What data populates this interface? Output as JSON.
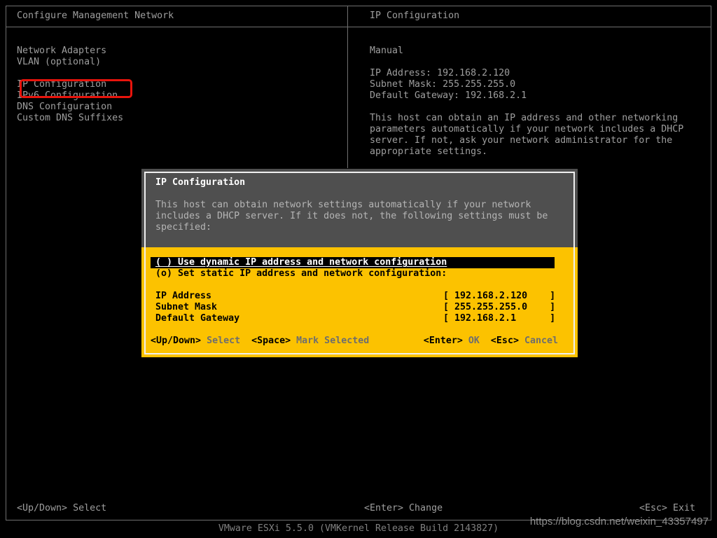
{
  "window": {
    "left_title": "Configure Management Network",
    "right_title": "IP Configuration"
  },
  "menu": {
    "items": [
      {
        "label": "Network Adapters"
      },
      {
        "label": "VLAN (optional)"
      },
      {
        "label": "IP Configuration",
        "annotated": true
      },
      {
        "label": "IPv6 Configuration"
      },
      {
        "label": "DNS Configuration"
      },
      {
        "label": "Custom DNS Suffixes"
      }
    ]
  },
  "details": {
    "mode": "Manual",
    "rows": [
      {
        "label": "IP Address:",
        "value": "192.168.2.120"
      },
      {
        "label": "Subnet Mask:",
        "value": "255.255.255.0"
      },
      {
        "label": "Default Gateway:",
        "value": "192.168.2.1"
      }
    ],
    "help_lines": [
      "This host can obtain an IP address and other networking",
      "parameters automatically if your network includes a DHCP",
      "server. If not, ask your network administrator for the",
      "appropriate settings."
    ]
  },
  "dialog": {
    "title": "IP Configuration",
    "body_lines": [
      "This host can obtain network settings automatically if your network",
      "includes a DHCP server. If it does not, the following settings must be",
      "specified:"
    ],
    "options": [
      {
        "text": "( ) Use dynamic IP address and network configuration",
        "focused": true,
        "checked": false
      },
      {
        "text": "(o) Set static IP address and network configuration:",
        "focused": false,
        "checked": true
      }
    ],
    "fields": [
      {
        "label": "IP Address",
        "value": "192.168.2.120",
        "display": "[ 192.168.2.120    ]"
      },
      {
        "label": "Subnet Mask",
        "value": "255.255.255.0",
        "display": "[ 255.255.255.0    ]"
      },
      {
        "label": "Default Gateway",
        "value": "192.168.2.1",
        "display": "[ 192.168.2.1      ]"
      }
    ],
    "hints_left": [
      {
        "key": "<Up/Down>",
        "action": "Select"
      },
      {
        "key": "<Space>",
        "action": "Mark Selected"
      }
    ],
    "hints_right": [
      {
        "key": "<Enter>",
        "action": "OK"
      },
      {
        "key": "<Esc>",
        "action": "Cancel"
      }
    ]
  },
  "footer": {
    "hints": [
      {
        "key": "<Up/Down>",
        "action": "Select"
      },
      {
        "key": "<Enter>",
        "action": "Change"
      },
      {
        "key": "<Esc>",
        "action": "Exit"
      }
    ]
  },
  "status": {
    "product_line": "VMware ESXi 5.5.0 (VMKernel Release Build 2143827)"
  },
  "watermark": {
    "text": "https://blog.csdn.net/weixin_43357497"
  },
  "colors": {
    "accent_yellow": "#fcc200",
    "dialog_gray": "#4f4f4f",
    "screen_text_gray": "#9e9e9e",
    "annotation_red": "#e8140c",
    "highlight_bar": "#000000"
  }
}
